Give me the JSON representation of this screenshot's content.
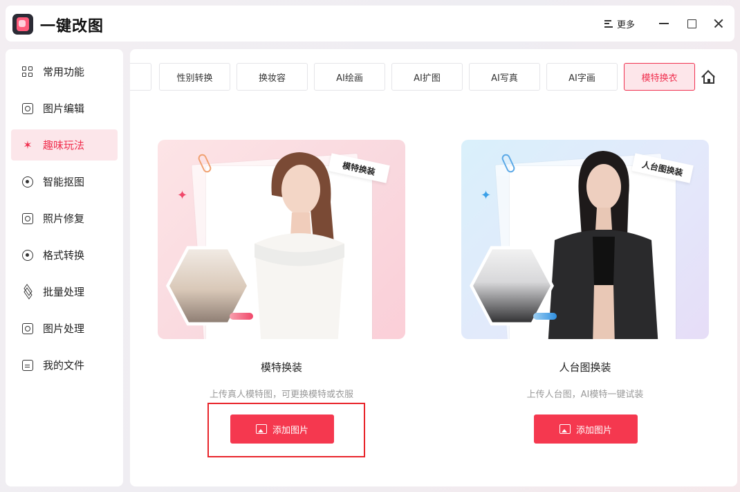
{
  "app": {
    "title": "一键改图",
    "more_label": "更多"
  },
  "sidebar": {
    "items": [
      {
        "label": "常用功能",
        "icon": "grid-icon",
        "active": false
      },
      {
        "label": "图片编辑",
        "icon": "edit-icon",
        "active": false
      },
      {
        "label": "趣味玩法",
        "icon": "sparkle-icon",
        "active": true
      },
      {
        "label": "智能抠图",
        "icon": "target-icon",
        "active": false
      },
      {
        "label": "照片修复",
        "icon": "repair-icon",
        "active": false
      },
      {
        "label": "格式转换",
        "icon": "convert-icon",
        "active": false
      },
      {
        "label": "批量处理",
        "icon": "layers-icon",
        "active": false
      },
      {
        "label": "图片处理",
        "icon": "image-icon",
        "active": false
      },
      {
        "label": "我的文件",
        "icon": "file-icon",
        "active": false
      }
    ]
  },
  "tabs": [
    {
      "label": "性别转换"
    },
    {
      "label": "换妆容"
    },
    {
      "label": "AI绘画"
    },
    {
      "label": "AI扩图"
    },
    {
      "label": "AI写真"
    },
    {
      "label": "AI字画"
    },
    {
      "label": "模特换衣",
      "active": true
    }
  ],
  "cards": [
    {
      "badge": "模特换装",
      "title": "模特换装",
      "desc": "上传真人模特图，可更换模特或衣服",
      "button": "添加图片"
    },
    {
      "badge": "人台图换装",
      "title": "人台图换装",
      "desc": "上传人台图，AI模特一键试装",
      "button": "添加图片"
    }
  ],
  "colors": {
    "accent": "#f5384f",
    "active_bg": "#fde6ea",
    "highlight": "#e8242a"
  }
}
